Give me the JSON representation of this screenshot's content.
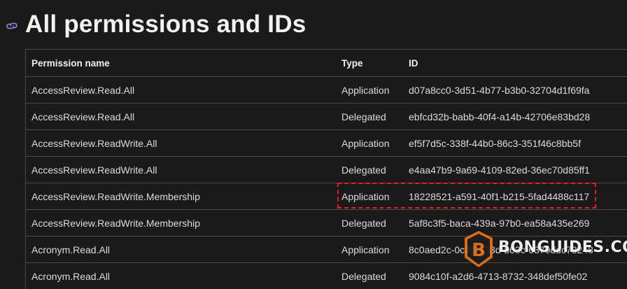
{
  "page": {
    "title": "All permissions and IDs",
    "icon": "link-icon"
  },
  "table": {
    "headers": [
      "Permission name",
      "Type",
      "ID"
    ],
    "rows": [
      {
        "name": "AccessReview.Read.All",
        "type": "Application",
        "id": "d07a8cc0-3d51-4b77-b3b0-32704d1f69fa"
      },
      {
        "name": "AccessReview.Read.All",
        "type": "Delegated",
        "id": "ebfcd32b-babb-40f4-a14b-42706e83bd28"
      },
      {
        "name": "AccessReview.ReadWrite.All",
        "type": "Application",
        "id": "ef5f7d5c-338f-44b0-86c3-351f46c8bb5f"
      },
      {
        "name": "AccessReview.ReadWrite.All",
        "type": "Delegated",
        "id": "e4aa47b9-9a69-4109-82ed-36ec70d85ff1"
      },
      {
        "name": "AccessReview.ReadWrite.Membership",
        "type": "Application",
        "id": "18228521-a591-40f1-b215-5fad4488c117"
      },
      {
        "name": "AccessReview.ReadWrite.Membership",
        "type": "Delegated",
        "id": "5af8c3f5-baca-439a-97b0-ea58a435e269"
      },
      {
        "name": "Acronym.Read.All",
        "type": "Application",
        "id": "8c0aed2c-0c61-433d-b63c-6370ddc73248"
      },
      {
        "name": "Acronym.Read.All",
        "type": "Delegated",
        "id": "9084c10f-a2d6-4713-8732-348def50fe02"
      }
    ]
  },
  "highlight": {
    "row_index": 4,
    "color": "#e0202a"
  },
  "watermark": {
    "text": "BONGUIDES.COM",
    "logo_letter": "B",
    "logo_color": "#e8731a"
  },
  "colors": {
    "background": "#1b1a19",
    "border": "#4a4a4a",
    "text": "#e6e6e6"
  }
}
